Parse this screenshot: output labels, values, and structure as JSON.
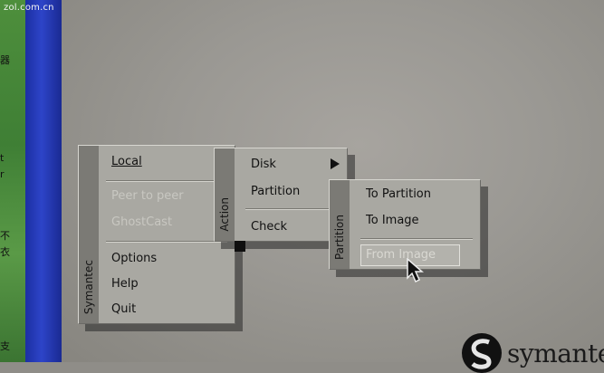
{
  "watermark": "zol.com.cn",
  "left_edge_glyphs": [
    "器",
    "t",
    "r",
    "不",
    "衣",
    "支"
  ],
  "main_menu": {
    "sidebar_label": "Symantec",
    "items": [
      {
        "label": "Local",
        "enabled": true
      },
      {
        "label": "Peer to peer",
        "enabled": false
      },
      {
        "label": "GhostCast",
        "enabled": false
      },
      {
        "label": "Options",
        "enabled": true
      },
      {
        "label": "Help",
        "enabled": true
      },
      {
        "label": "Quit",
        "enabled": true
      }
    ]
  },
  "action_menu": {
    "sidebar_label": "Action",
    "items": [
      {
        "label": "Disk",
        "has_submenu": true
      },
      {
        "label": "Partition",
        "has_submenu": false
      },
      {
        "label": "Check",
        "has_submenu": false
      }
    ]
  },
  "partition_menu": {
    "sidebar_label": "Partition",
    "items": [
      {
        "label": "To Partition",
        "selected": false
      },
      {
        "label": "To Image",
        "selected": false
      },
      {
        "label": "From Image",
        "selected": true
      }
    ]
  },
  "logo": {
    "text": "symantec"
  },
  "colors": {
    "menu_bg": "#a9a8a2",
    "sidebar_bg": "#7b7a75",
    "desktop_bg": "#9a9893",
    "blue_bar": "#2d44c8",
    "disabled_text": "#c8c7c1"
  }
}
